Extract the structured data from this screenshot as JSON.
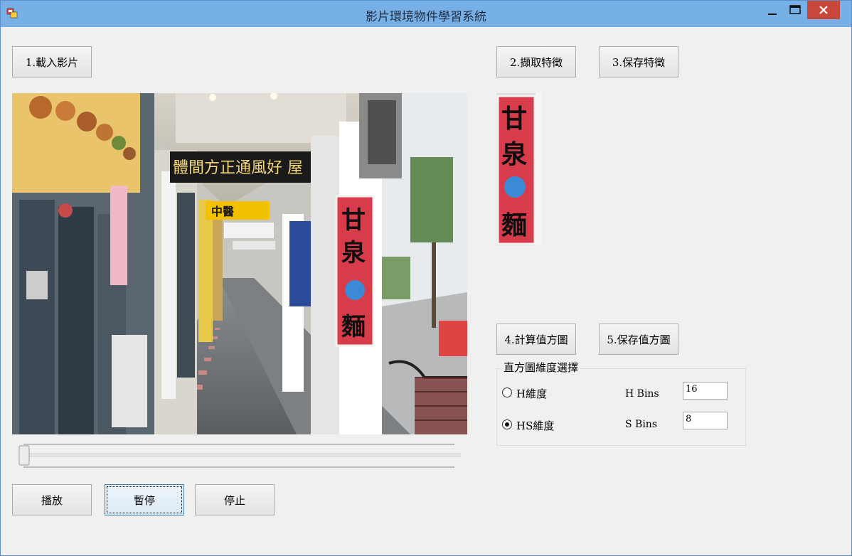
{
  "window": {
    "title": "影片環境物件學習系統",
    "controls": {
      "minimize": "—",
      "maximize": "☐",
      "close": "✕"
    }
  },
  "buttons": {
    "load_video": "1.載入影片",
    "extract_feature": "2.擷取特徵",
    "save_feature": "3.保存特徵",
    "compute_histogram": "4.計算值方圖",
    "save_histogram": "5.保存值方圖",
    "play": "播放",
    "pause": "暫停",
    "stop": "停止"
  },
  "video": {
    "led_sign": "體間方正通風好 屋",
    "store_sign_chars": [
      "甘",
      "泉",
      "麵"
    ],
    "store_sign_mid": "中醫",
    "slider_position": 0.0
  },
  "feature": {
    "chars": [
      "甘",
      "泉",
      "麵"
    ]
  },
  "histogram": {
    "group_title": "直方圖維度選擇",
    "options": [
      {
        "label": "H維度",
        "checked": false
      },
      {
        "label": "HS維度",
        "checked": true
      }
    ],
    "h_bins_label": "H Bins",
    "h_bins_value": "16",
    "s_bins_label": "S Bins",
    "s_bins_value": "8"
  },
  "colors": {
    "titlebar": "#77b0e6",
    "close": "#c9473a",
    "sign_red": "#d83c4a"
  }
}
